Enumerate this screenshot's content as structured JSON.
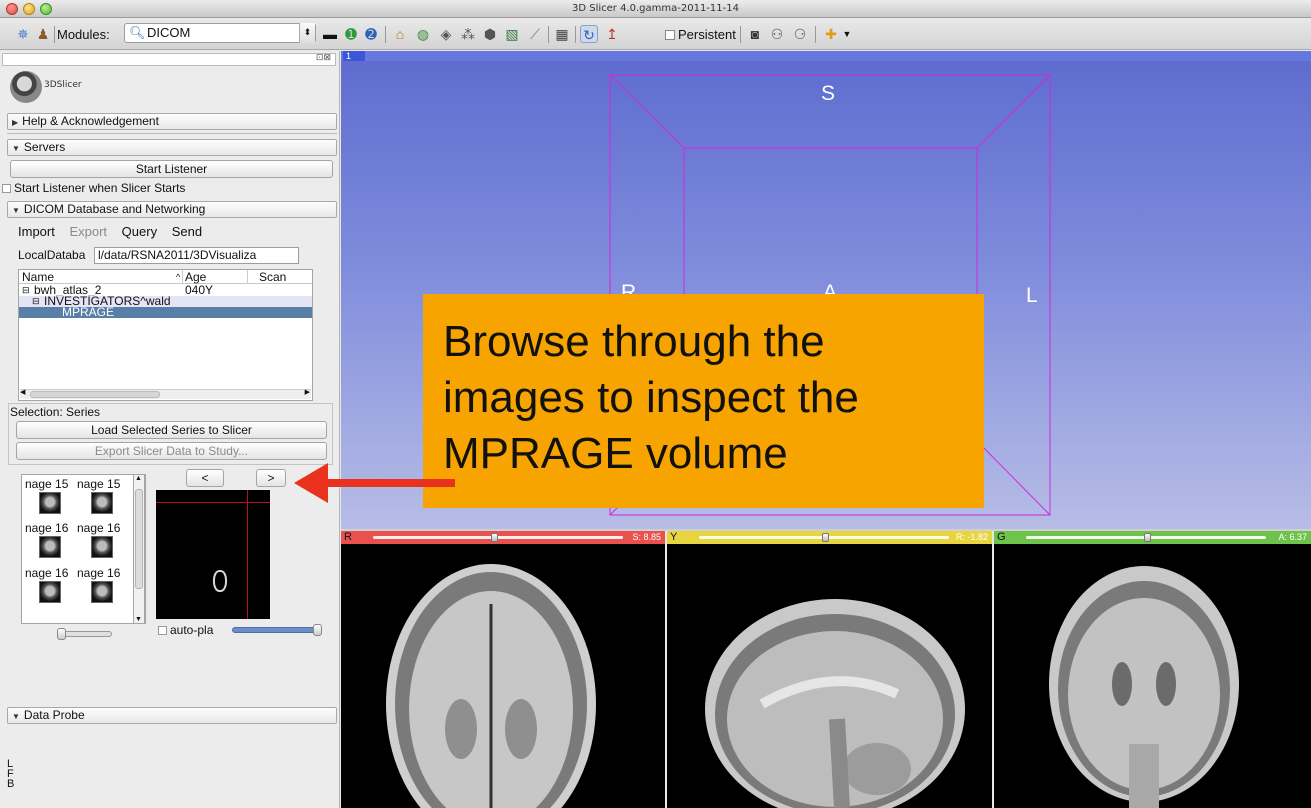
{
  "window": {
    "title": "3D Slicer 4.0.gamma-2011-11-14"
  },
  "toolbar": {
    "modules_label": "Modules:",
    "module_value": "DICOM",
    "persistent_label": "Persistent"
  },
  "panel": {
    "logo_text": "3DSlicer",
    "help_section": "Help & Acknowledgement",
    "servers_section": "Servers",
    "start_listener_button": "Start Listener",
    "start_listener_checkbox": "Start Listener when Slicer Starts",
    "dicom_section": "DICOM Database and Networking",
    "tabs": [
      "Import",
      "Export",
      "Query",
      "Send"
    ],
    "localdb_label": "LocalDataba",
    "localdb_value": "l/data/RSNA2011/3DVisualiza",
    "tree": {
      "columns": [
        "Name",
        "Age",
        "Scan"
      ],
      "rows": [
        {
          "name": "bwh_atlas_2",
          "age": "040Y"
        },
        {
          "name": "INVESTIGATORS^wald",
          "age": ""
        },
        {
          "name": "MPRAGE",
          "age": ""
        }
      ],
      "sort_indicator": "^"
    },
    "selection_label": "Selection: Series",
    "load_button": "Load Selected Series to Slicer",
    "export_button": "Export Slicer Data to Study...",
    "thumbnails": [
      "nage 15",
      "nage 15",
      "nage 16",
      "nage 16",
      "nage 16",
      "nage 16"
    ],
    "prev_button": "<",
    "next_button": ">",
    "autoplay_label": "auto-pla",
    "data_probe_section": "Data Probe",
    "probe_lines": [
      "L",
      "F",
      "B"
    ]
  },
  "view3d": {
    "pin_label": "1",
    "orient_top": "S",
    "orient_left": "R",
    "orient_center": "A",
    "orient_right": "L"
  },
  "callout": {
    "lines": [
      "Browse through the",
      "images to inspect the",
      "MPRAGE volume"
    ],
    "color": "#f7a400",
    "arrow_color": "#e8321e"
  },
  "slices": {
    "red": {
      "label": "R",
      "value": "S: 8.85",
      "color": "#e8514e"
    },
    "yellow": {
      "label": "Y",
      "value": "R: -1.82",
      "color": "#e8d540"
    },
    "green": {
      "label": "G",
      "value": "A: 6.37",
      "color": "#6ec34a"
    }
  }
}
